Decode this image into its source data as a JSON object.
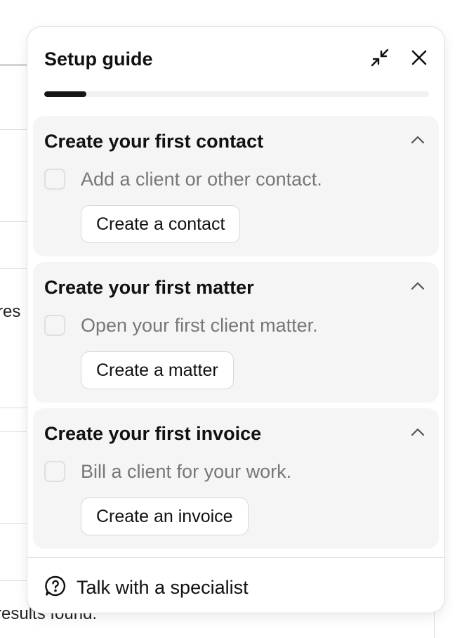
{
  "background": {
    "fragment_res": "res",
    "fragment_results": "results found."
  },
  "setup_guide": {
    "title": "Setup guide",
    "progress_fraction": 0.11,
    "collapse_icon": "minimize-arrows-icon",
    "close_icon": "close-icon",
    "steps": [
      {
        "title": "Create your first contact",
        "description": "Add a client or other contact.",
        "button_label": "Create a contact",
        "completed": false,
        "expanded": true
      },
      {
        "title": "Create your first matter",
        "description": "Open your first client matter.",
        "button_label": "Create a matter",
        "completed": false,
        "expanded": true
      },
      {
        "title": "Create your first invoice",
        "description": "Bill a client for your work.",
        "button_label": "Create an invoice",
        "completed": false,
        "expanded": true
      }
    ],
    "footer": {
      "icon": "help-circle-icon",
      "label": "Talk with a specialist"
    }
  },
  "colors": {
    "progress_fill": "#151515",
    "card_bg": "#f5f5f5",
    "muted_text": "#777777"
  }
}
